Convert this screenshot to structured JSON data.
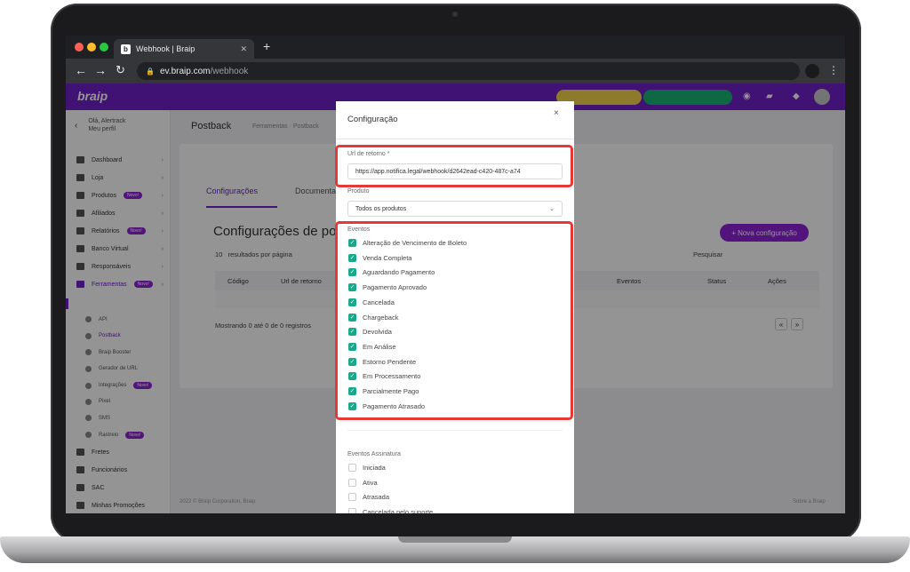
{
  "browser": {
    "tab_title": "Webhook | Braip",
    "tab_favicon": "b",
    "url_host": "ev.braip.com",
    "url_path": "/webhook",
    "traffic_light_colors": [
      "#ff5f57",
      "#febc2e",
      "#28c840"
    ]
  },
  "app": {
    "brand": "braip",
    "accent_color": "#6e1fc6",
    "profile": {
      "greeting": "Olá, Alertrack",
      "link": "Meu perfil"
    },
    "sidebar": [
      {
        "label": "Dashboard",
        "icon": "chart-icon"
      },
      {
        "label": "Loja",
        "icon": "grid-icon"
      },
      {
        "label": "Produtos",
        "icon": "box-icon",
        "badge": "Novo!"
      },
      {
        "label": "Afiliados",
        "icon": "users-icon"
      },
      {
        "label": "Relatórios",
        "icon": "report-icon",
        "badge": "Novo!"
      },
      {
        "label": "Banco Virtual",
        "icon": "bank-icon"
      },
      {
        "label": "Responsáveis",
        "icon": "person-icon"
      },
      {
        "label": "Ferramentas",
        "icon": "wrench-icon",
        "badge": "Novo!",
        "active": true
      }
    ],
    "sidebar_sub": [
      {
        "label": "API"
      },
      {
        "label": "Postback"
      },
      {
        "label": "Braip Booster"
      },
      {
        "label": "Gerador de URL"
      },
      {
        "label": "Integrações",
        "badge": "Novo!"
      },
      {
        "label": "Pixel"
      },
      {
        "label": "SMS"
      },
      {
        "label": "Rastreio",
        "badge": "Novo!"
      }
    ],
    "sidebar_bottom": [
      {
        "label": "Fretes"
      },
      {
        "label": "Funcionários"
      },
      {
        "label": "SAC"
      },
      {
        "label": "Minhas Promoções"
      }
    ],
    "page_title": "Postback",
    "breadcrumb": "Ferramentas · Postback",
    "tabs": [
      "Configurações",
      "Documentação"
    ],
    "card_title": "Configurações de postback",
    "new_button": "+ Nova configuração",
    "per_page_value": "10",
    "per_page_label": "resultados por página",
    "search_label": "Pesquisar",
    "table_headers": [
      "Código",
      "Url de retorno",
      "Eventos",
      "Status",
      "Ações"
    ],
    "showing": "Mostrando 0 até 0 de 0 registros",
    "pager_prev": "«",
    "pager_next": "»",
    "footer_left": "2022 © Braip Corporation, Braip",
    "footer_right": "Sobre a Braip"
  },
  "modal": {
    "title": "Configuração",
    "close": "×",
    "url_label": "Url de retorno *",
    "url_value": "https://app.notifica.legal/webhook/d2642ead-c420-487c-a74",
    "product_label": "Produto",
    "product_value": "Todos os produtos",
    "events_label": "Eventos",
    "events": [
      "Alteração de Vencimento de Boleto",
      "Venda Completa",
      "Aguardando Pagamento",
      "Pagamento Aprovado",
      "Cancelada",
      "Chargeback",
      "Devolvida",
      "Em Análise",
      "Estorno Pendente",
      "Em Processamento",
      "Parcialmente Pago",
      "Pagamento Atrasado"
    ],
    "sub_events_label": "Eventos Assinatura",
    "sub_events": [
      "Iniciada",
      "Ativa",
      "Atrasada",
      "Cancelada pelo suporte"
    ],
    "checkbox_color": "#1aa88b",
    "highlight_color": "#e53935"
  }
}
